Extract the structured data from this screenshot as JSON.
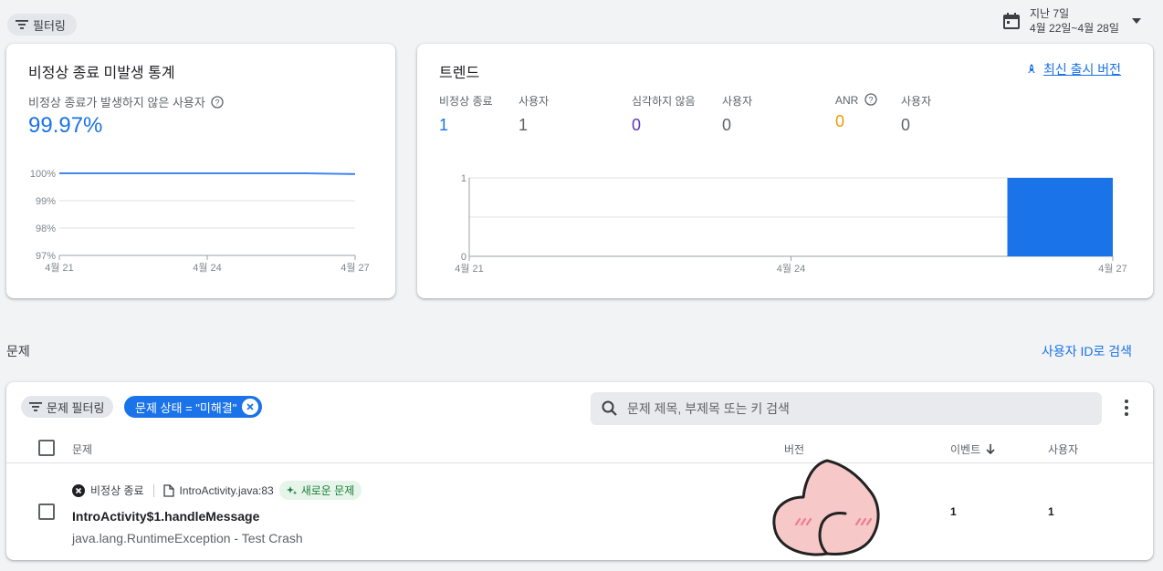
{
  "top_filter": {
    "label": "필터링",
    "icon": "filter-icon"
  },
  "date_range": {
    "title": "지난 7일",
    "range": "4월 22일~4월 28일",
    "icon": "calendar-icon"
  },
  "crash_free": {
    "title": "비정상 종료 미발생 통계",
    "stat_label": "비정상 종료가 발생하지 않은 사용자",
    "value": "99.97%",
    "chart_data": {
      "type": "line",
      "x": [
        "4월 21",
        "4월 22",
        "4월 23",
        "4월 24",
        "4월 25",
        "4월 26",
        "4월 27"
      ],
      "x_tick_labels": [
        "4월 21",
        "4월 24",
        "4월 27"
      ],
      "series": [
        {
          "values": [
            100,
            100,
            100,
            100,
            100,
            100,
            99.97
          ]
        }
      ],
      "y_tick_labels": [
        "100%",
        "99%",
        "98%",
        "97%"
      ],
      "ylim": [
        97,
        100
      ],
      "grid": true,
      "color": "#4285f4"
    }
  },
  "trend": {
    "title": "트렌드",
    "latest_release_link": "최신 출시 버전",
    "stats": [
      {
        "label": "비정상 종료",
        "value": "1",
        "color": "#1a73e8"
      },
      {
        "label": "사용자",
        "value": "1",
        "color": "#5f6368"
      },
      {
        "label": "심각하지 않음",
        "value": "0",
        "color": "#5e35b1"
      },
      {
        "label": "사용자",
        "value": "0",
        "color": "#5f6368"
      },
      {
        "label": "ANR",
        "value": "0",
        "color": "#f29900"
      },
      {
        "label": "사용자",
        "value": "0",
        "color": "#5f6368"
      }
    ],
    "chart_data": {
      "type": "bar",
      "categories": [
        "4월 21",
        "4월 22",
        "4월 23",
        "4월 24",
        "4월 25",
        "4월 26",
        "4월 27"
      ],
      "x_tick_labels": [
        "4월 21",
        "4월 24",
        "4월 27"
      ],
      "values": [
        0,
        0,
        0,
        0,
        0,
        0,
        1
      ],
      "y_tick_labels": [
        "1",
        "0"
      ],
      "ylim": [
        0,
        1
      ],
      "grid": true,
      "color": "#1a73e8"
    }
  },
  "issues": {
    "section_title": "문제",
    "user_search_link": "사용자 ID로 검색",
    "filter_chip": "문제 필터링",
    "status_chip": "문제 상태 = \"미해결\"",
    "search_placeholder": "문제 제목, 부제목 또는 키 검색",
    "columns": {
      "issue": "문제",
      "version": "버전",
      "events": "이벤트",
      "users": "사용자"
    },
    "rows": [
      {
        "type": "비정상 종료",
        "file": "IntroActivity.java:83",
        "badge": "새로운 문제",
        "title": "IntroActivity$1.handleMessage",
        "subtitle": "java.lang.RuntimeException - Test Crash",
        "events": "1",
        "users": "1"
      }
    ]
  }
}
